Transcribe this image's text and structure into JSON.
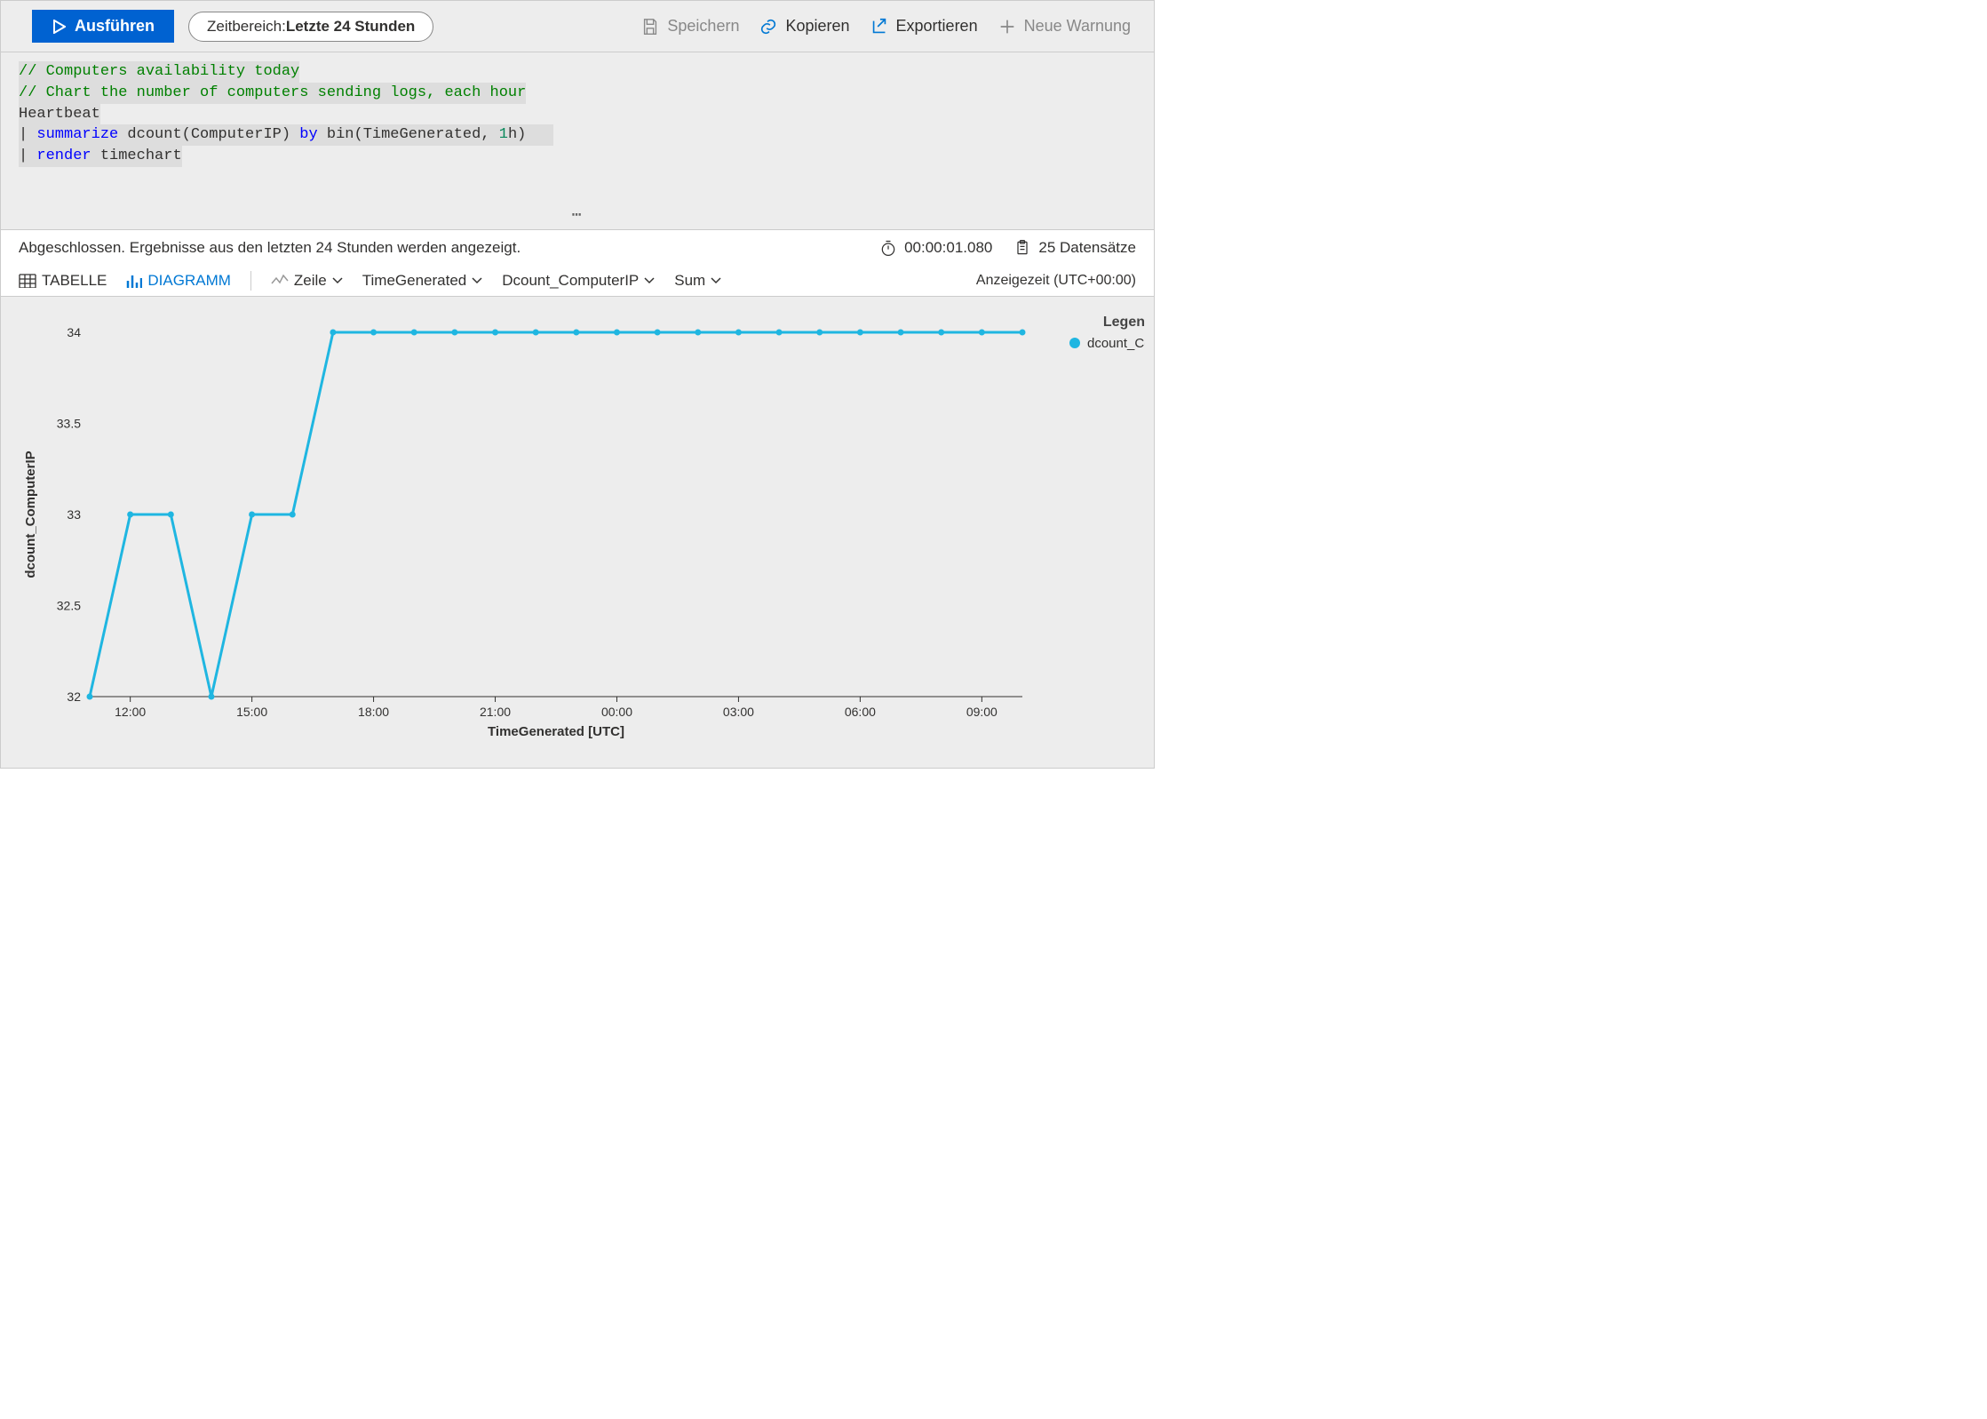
{
  "toolbar": {
    "run_label": "Ausführen",
    "time_range_prefix": "Zeitbereich: ",
    "time_range_value": "Letzte 24 Stunden",
    "save_label": "Speichern",
    "copy_label": "Kopieren",
    "export_label": "Exportieren",
    "new_alert_label": "Neue Warnung"
  },
  "query": {
    "line1": "// Computers availability today",
    "line2": "// Chart the number of computers sending logs, each hour",
    "line3_text": "Heartbeat",
    "line4": {
      "pipe": "| ",
      "kw1": "summarize",
      "mid": " dcount(ComputerIP) ",
      "kw2": "by",
      "mid2": " bin(TimeGenerated, ",
      "num": "1",
      "tail": "h)"
    },
    "line5": {
      "pipe": "| ",
      "kw": "render",
      "tail": " timechart"
    }
  },
  "status": {
    "text": "Abgeschlossen. Ergebnisse aus den letzten 24 Stunden werden angezeigt.",
    "duration": "00:00:01.080",
    "records": "25 Datensätze"
  },
  "view": {
    "table_label": "TABELLE",
    "chart_label": "DIAGRAMM",
    "type_label": "Zeile",
    "x_label": "TimeGenerated",
    "y_label": "Dcount_ComputerIP",
    "agg_label": "Sum",
    "tz_label": "Anzeigezeit (UTC+00:00)"
  },
  "legend": {
    "title": "Legen",
    "item": "dcount_Compu"
  },
  "chart_data": {
    "type": "line",
    "title": "",
    "xlabel": "TimeGenerated [UTC]",
    "ylabel": "dcount_ComputerIP",
    "ylim": [
      32,
      34
    ],
    "y_ticks": [
      32,
      32.5,
      33,
      33.5,
      34
    ],
    "x_tick_labels": [
      "12:00",
      "15:00",
      "18:00",
      "21:00",
      "00:00",
      "03:00",
      "06:00",
      "09:00"
    ],
    "x_tick_positions": [
      1,
      4,
      7,
      10,
      13,
      16,
      19,
      22
    ],
    "series": [
      {
        "name": "dcount_ComputerIP",
        "x": [
          0,
          1,
          2,
          3,
          4,
          5,
          6,
          7,
          8,
          9,
          10,
          11,
          12,
          13,
          14,
          15,
          16,
          17,
          18,
          19,
          20,
          21,
          22,
          23
        ],
        "values": [
          32,
          33,
          33,
          32,
          33,
          33,
          34,
          34,
          34,
          34,
          34,
          34,
          34,
          34,
          34,
          34,
          34,
          34,
          34,
          34,
          34,
          34,
          34,
          34
        ]
      }
    ]
  }
}
